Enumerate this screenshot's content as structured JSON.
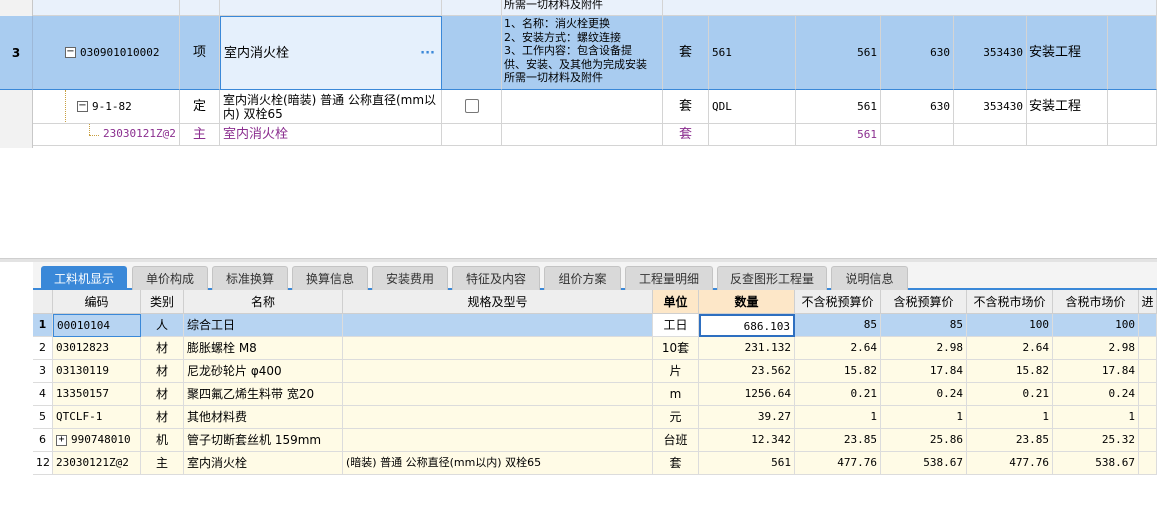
{
  "upper_rows": [
    {
      "fragment": "所需一切材料及附件"
    },
    {
      "index": "3",
      "code": "030901010002",
      "type": "项",
      "name": "室内消火栓",
      "more": "···",
      "desc": [
        "1、名称：消火栓更换",
        "2、安装方式：螺纹连接",
        "3、工作内容：包含设备提",
        "供、安装、及其他为完成安装",
        "所需一切材料及附件"
      ],
      "unit": "套",
      "qty_expr": "561",
      "qty": "561",
      "price": "630",
      "total": "353430",
      "category": "安装工程"
    },
    {
      "code": "9-1-82",
      "type": "定",
      "name": "室内消火栓(暗装) 普通 公称直径(mm以内) 双栓65",
      "unit": "套",
      "qty_expr": "QDL",
      "qty": "561",
      "price": "630",
      "total": "353430",
      "category": "安装工程"
    },
    {
      "code": "23030121Z@2",
      "type": "主",
      "name": "室内消火栓",
      "unit": "套",
      "qty": "561"
    }
  ],
  "tabs": [
    "工料机显示",
    "单价构成",
    "标准换算",
    "换算信息",
    "安装费用",
    "特征及内容",
    "组价方案",
    "工程量明细",
    "反查图形工程量",
    "说明信息"
  ],
  "columns": [
    "编码",
    "类别",
    "名称",
    "规格及型号",
    "单位",
    "数量",
    "不含税预算价",
    "含税预算价",
    "不含税市场价",
    "含税市场价",
    "进"
  ],
  "rows": [
    [
      "1",
      "00010104",
      "人",
      "综合工日",
      "",
      "工日",
      "686.103",
      "85",
      "85",
      "100",
      "100"
    ],
    [
      "2",
      "03012823",
      "材",
      "膨胀螺栓 M8",
      "",
      "10套",
      "231.132",
      "2.64",
      "2.98",
      "2.64",
      "2.98"
    ],
    [
      "3",
      "03130119",
      "材",
      "尼龙砂轮片 φ400",
      "",
      "片",
      "23.562",
      "15.82",
      "17.84",
      "15.82",
      "17.84"
    ],
    [
      "4",
      "13350157",
      "材",
      "聚四氟乙烯生料带 宽20",
      "",
      "m",
      "1256.64",
      "0.21",
      "0.24",
      "0.21",
      "0.24"
    ],
    [
      "5",
      "QTCLF-1",
      "材",
      "其他材料费",
      "",
      "元",
      "39.27",
      "1",
      "1",
      "1",
      "1"
    ],
    [
      "6",
      "990748010",
      "机",
      "管子切断套丝机 159mm",
      "",
      "台班",
      "12.342",
      "23.85",
      "25.86",
      "23.85",
      "25.32"
    ],
    [
      "12",
      "23030121Z@2",
      "主",
      "室内消火栓",
      "(暗装) 普通 公称直径(mm以内) 双栓65",
      "套",
      "561",
      "477.76",
      "538.67",
      "477.76",
      "538.67"
    ]
  ],
  "colors": {
    "selected_row": "#a9ccf0",
    "tab_active": "#3a88d8",
    "material_text": "#8b2e8f",
    "header_highlight": "#fde7c8"
  }
}
